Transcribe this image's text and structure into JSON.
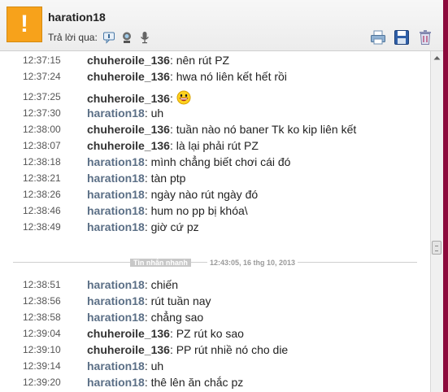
{
  "header": {
    "avatar_glyph": "!",
    "avatar_color": "#f7a21b",
    "contact_name": "haration18",
    "reply_label": "Trả lời qua:",
    "reply_icons": [
      "im-message-icon",
      "webcam-icon",
      "microphone-icon"
    ],
    "tools": [
      "print-icon",
      "save-icon",
      "delete-icon"
    ]
  },
  "chat": {
    "messages_before": [
      {
        "time": "12:37:15",
        "sender": "chuheroile_136",
        "text": " nên rút PZ"
      },
      {
        "time": "12:37:24",
        "sender": "chuheroile_136",
        "text": " hwa nó liên kết hết rồi"
      },
      {
        "time": "12:37:25",
        "sender": "chuheroile_136",
        "text": " ",
        "emoji": "grinning-emoticon"
      },
      {
        "time": "12:37:30",
        "sender": "haration18",
        "text": " uh"
      },
      {
        "time": "12:38:00",
        "sender": "chuheroile_136",
        "text": " tuần nào nó baner Tk ko kip liên kết"
      },
      {
        "time": "12:38:07",
        "sender": "chuheroile_136",
        "text": " là lại phải rút PZ"
      },
      {
        "time": "12:38:18",
        "sender": "haration18",
        "text": " mình chẳng biết chơi cái đó"
      },
      {
        "time": "12:38:21",
        "sender": "haration18",
        "text": " tàn ptp"
      },
      {
        "time": "12:38:26",
        "sender": "haration18",
        "text": " ngày nào rút ngày đó"
      },
      {
        "time": "12:38:46",
        "sender": "haration18",
        "text": " hum no pp bị khóa\\"
      },
      {
        "time": "12:38:49",
        "sender": "haration18",
        "text": " giờ cứ pz"
      }
    ],
    "divider": {
      "label": "Tin nhắn nhanh",
      "timestamp": "12:43:05, 16 thg 10, 2013"
    },
    "messages_after": [
      {
        "time": "12:38:51",
        "sender": "haration18",
        "text": " chiến"
      },
      {
        "time": "12:38:56",
        "sender": "haration18",
        "text": " rút tuần nay"
      },
      {
        "time": "12:38:58",
        "sender": "haration18",
        "text": " chẳng sao"
      },
      {
        "time": "12:39:04",
        "sender": "chuheroile_136",
        "text": " PZ rút ko sao"
      },
      {
        "time": "12:39:10",
        "sender": "chuheroile_136",
        "text": " PP rút nhiề nó cho die"
      },
      {
        "time": "12:39:14",
        "sender": "haration18",
        "text": " uh"
      },
      {
        "time": "12:39:20",
        "sender": "haration18",
        "text": " thê lên ăn chắc pz"
      }
    ]
  },
  "colors": {
    "me_sender": "#5b6f86",
    "other_sender": "#333333",
    "accent_edge": "#8c0a3c"
  }
}
